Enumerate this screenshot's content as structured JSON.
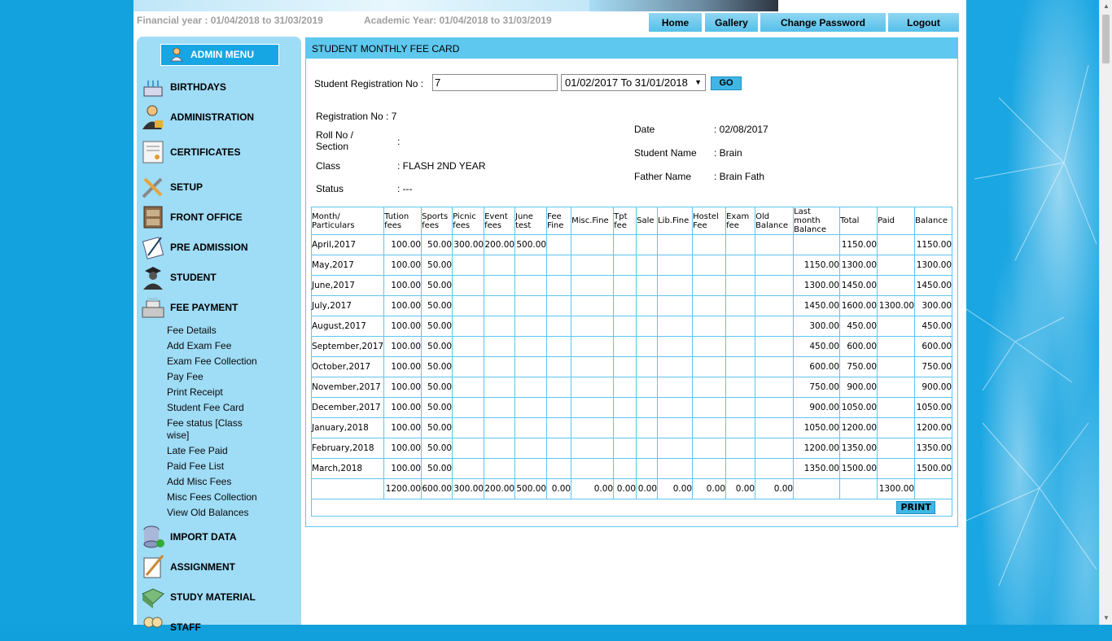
{
  "header": {
    "financial_year": "Financial year : 01/04/2018 to 31/03/2019",
    "academic_year": "Academic Year: 01/04/2018 to 31/03/2019",
    "nav": [
      "Home",
      "Gallery",
      "Change Password",
      "Logout"
    ]
  },
  "sidebar": {
    "admin_menu": "ADMIN MENU",
    "items": [
      {
        "label": "BIRTHDAYS",
        "icon": "cake-icon"
      },
      {
        "label": "ADMINISTRATION",
        "icon": "user-lock-icon"
      },
      {
        "label": "CERTIFICATES",
        "icon": "certificate-icon"
      },
      {
        "label": "SETUP",
        "icon": "tools-icon"
      },
      {
        "label": "FRONT OFFICE",
        "icon": "cabinet-icon"
      },
      {
        "label": "PRE ADMISSION",
        "icon": "pen-document-icon"
      },
      {
        "label": "STUDENT",
        "icon": "student-icon"
      },
      {
        "label": "FEE PAYMENT",
        "icon": "cash-register-icon"
      },
      {
        "label": "IMPORT DATA",
        "icon": "database-import-icon"
      },
      {
        "label": "ASSIGNMENT",
        "icon": "pencil-paper-icon"
      },
      {
        "label": "STUDY MATERIAL",
        "icon": "book-icon"
      },
      {
        "label": "STAFF",
        "icon": "staff-icon"
      }
    ],
    "fee_sub_items": [
      "Fee Details",
      "Add Exam Fee",
      "Exam Fee Collection",
      "Pay Fee",
      "Print Receipt",
      "Student Fee Card",
      "Fee status [Class wise]",
      "Late Fee Paid",
      "Paid Fee List",
      "Add Misc Fees",
      "Misc Fees Collection",
      "View Old Balances"
    ]
  },
  "panel": {
    "title": "STUDENT MONTHLY FEE CARD",
    "reg_label": "Student Registration No :",
    "reg_value": "7",
    "date_range": "01/02/2017 To 31/01/2018",
    "go": "GO",
    "info": {
      "registration_no_label": "Registration No : 7",
      "roll_label": "Roll No / Section",
      "roll_value": ":",
      "class_label": "Class",
      "class_value": ": FLASH 2ND YEAR",
      "status_label": "Status",
      "status_value": ": ---",
      "date_label": "Date",
      "date_value": ": 02/08/2017",
      "student_name_label": "Student Name",
      "student_name_value": ": Brain",
      "father_name_label": "Father Name",
      "father_name_value": ": Brain Fath"
    },
    "table": {
      "headers": [
        "Month/ Particulars",
        "Tution fees",
        "Sports fees",
        "Picnic fees",
        "Event fees",
        "June test",
        "Fee Fine",
        "Misc.Fine",
        "Tpt fee",
        "Sale",
        "Lib.Fine",
        "Hostel Fee",
        "Exam fee",
        "Old Balance",
        "Last month Balance",
        "Total",
        "Paid",
        "Balance"
      ],
      "rows": [
        [
          "April,2017",
          "100.00",
          "50.00",
          "300.00",
          "200.00",
          "500.00",
          "",
          "",
          "",
          "",
          "",
          "",
          "",
          "",
          "",
          "1150.00",
          "",
          "1150.00"
        ],
        [
          "May,2017",
          "100.00",
          "50.00",
          "",
          "",
          "",
          "",
          "",
          "",
          "",
          "",
          "",
          "",
          "",
          "1150.00",
          "1300.00",
          "",
          "1300.00"
        ],
        [
          "June,2017",
          "100.00",
          "50.00",
          "",
          "",
          "",
          "",
          "",
          "",
          "",
          "",
          "",
          "",
          "",
          "1300.00",
          "1450.00",
          "",
          "1450.00"
        ],
        [
          "July,2017",
          "100.00",
          "50.00",
          "",
          "",
          "",
          "",
          "",
          "",
          "",
          "",
          "",
          "",
          "",
          "1450.00",
          "1600.00",
          "1300.00",
          "300.00"
        ],
        [
          "August,2017",
          "100.00",
          "50.00",
          "",
          "",
          "",
          "",
          "",
          "",
          "",
          "",
          "",
          "",
          "",
          "300.00",
          "450.00",
          "",
          "450.00"
        ],
        [
          "September,2017",
          "100.00",
          "50.00",
          "",
          "",
          "",
          "",
          "",
          "",
          "",
          "",
          "",
          "",
          "",
          "450.00",
          "600.00",
          "",
          "600.00"
        ],
        [
          "October,2017",
          "100.00",
          "50.00",
          "",
          "",
          "",
          "",
          "",
          "",
          "",
          "",
          "",
          "",
          "",
          "600.00",
          "750.00",
          "",
          "750.00"
        ],
        [
          "November,2017",
          "100.00",
          "50.00",
          "",
          "",
          "",
          "",
          "",
          "",
          "",
          "",
          "",
          "",
          "",
          "750.00",
          "900.00",
          "",
          "900.00"
        ],
        [
          "December,2017",
          "100.00",
          "50.00",
          "",
          "",
          "",
          "",
          "",
          "",
          "",
          "",
          "",
          "",
          "",
          "900.00",
          "1050.00",
          "",
          "1050.00"
        ],
        [
          "January,2018",
          "100.00",
          "50.00",
          "",
          "",
          "",
          "",
          "",
          "",
          "",
          "",
          "",
          "",
          "",
          "1050.00",
          "1200.00",
          "",
          "1200.00"
        ],
        [
          "February,2018",
          "100.00",
          "50.00",
          "",
          "",
          "",
          "",
          "",
          "",
          "",
          "",
          "",
          "",
          "",
          "1200.00",
          "1350.00",
          "",
          "1350.00"
        ],
        [
          "March,2018",
          "100.00",
          "50.00",
          "",
          "",
          "",
          "",
          "",
          "",
          "",
          "",
          "",
          "",
          "",
          "1350.00",
          "1500.00",
          "",
          "1500.00"
        ]
      ],
      "totals": [
        "",
        "1200.00",
        "600.00",
        "300.00",
        "200.00",
        "500.00",
        "0.00",
        "0.00",
        "0.00",
        "0.00",
        "0.00",
        "0.00",
        "0.00",
        "0.00",
        "",
        "",
        "1300.00",
        ""
      ],
      "print": "PRINT"
    }
  }
}
